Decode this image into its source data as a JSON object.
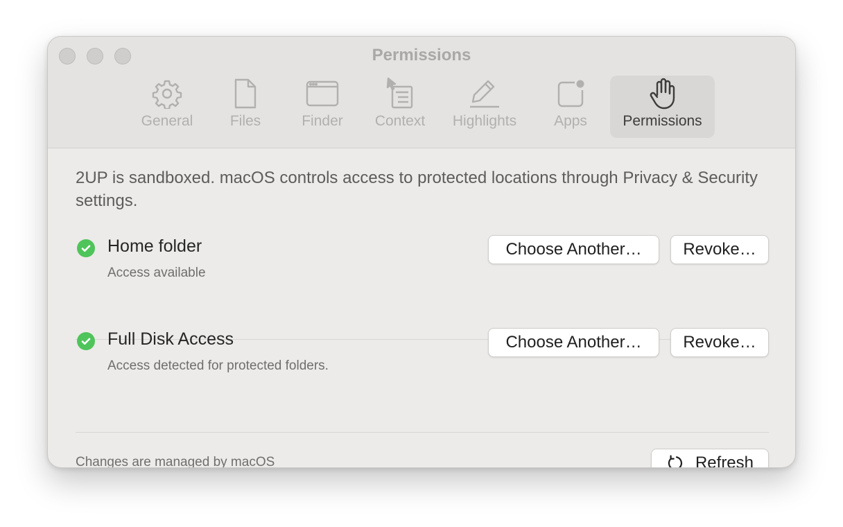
{
  "window": {
    "title": "Permissions"
  },
  "tabs": [
    {
      "label": "General",
      "icon": "gear-icon"
    },
    {
      "label": "Files",
      "icon": "document-icon"
    },
    {
      "label": "Finder",
      "icon": "window-icon"
    },
    {
      "label": "Context",
      "icon": "context-menu-icon"
    },
    {
      "label": "Highlights",
      "icon": "pencil-icon"
    },
    {
      "label": "Apps",
      "icon": "app-badge-icon"
    },
    {
      "label": "Permissions",
      "icon": "hand-icon"
    }
  ],
  "active_tab": "Permissions",
  "intro_text": "2UP is sandboxed. macOS controls access to protected locations through Privacy & Security settings.",
  "permissions": [
    {
      "title": "Home folder",
      "status": "Access available",
      "choose_label": "Choose Another…",
      "revoke_label": "Revoke…"
    },
    {
      "title": "Full Disk Access",
      "status": "Access detected for protected folders.",
      "choose_label": "Choose Another…",
      "revoke_label": "Revoke…"
    }
  ],
  "footer": {
    "text": "Changes are managed by macOS",
    "refresh_label": "Refresh"
  },
  "colors": {
    "window_bg": "#ecebe9",
    "toolbar_bg": "#e4e3e1",
    "status_ok": "#4fc45a",
    "active_tab_bg": "#d8d7d5"
  }
}
